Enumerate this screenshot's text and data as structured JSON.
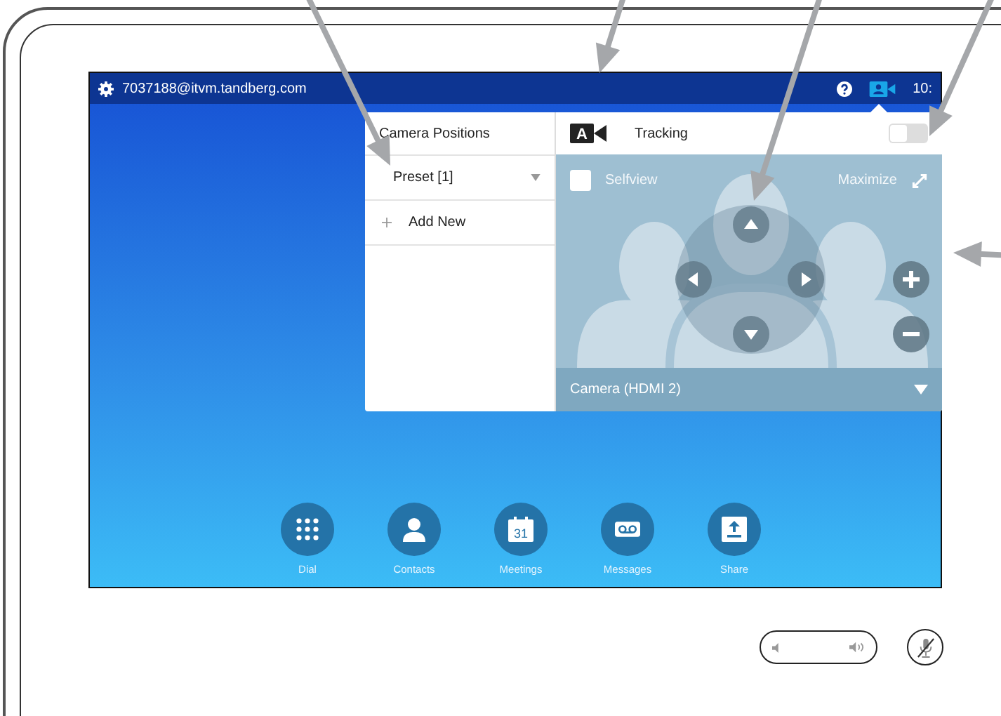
{
  "status_bar": {
    "address": "7037188@itvm.tandberg.com",
    "time": "10:"
  },
  "camera_panel": {
    "title": "Camera Positions",
    "preset": "Preset [1]",
    "add_label": "Add New",
    "tracking": {
      "badge": "A",
      "label": "Tracking",
      "on": false
    },
    "selfview": {
      "label": "Selfview",
      "checked": false
    },
    "maximize": "Maximize",
    "source": "Camera (HDMI 2)"
  },
  "dock": [
    {
      "kind": "dial",
      "label": "Dial"
    },
    {
      "kind": "contacts",
      "label": "Contacts"
    },
    {
      "kind": "meetings",
      "label": "Meetings",
      "day": "31"
    },
    {
      "kind": "messages",
      "label": "Messages"
    },
    {
      "kind": "share",
      "label": "Share"
    }
  ]
}
